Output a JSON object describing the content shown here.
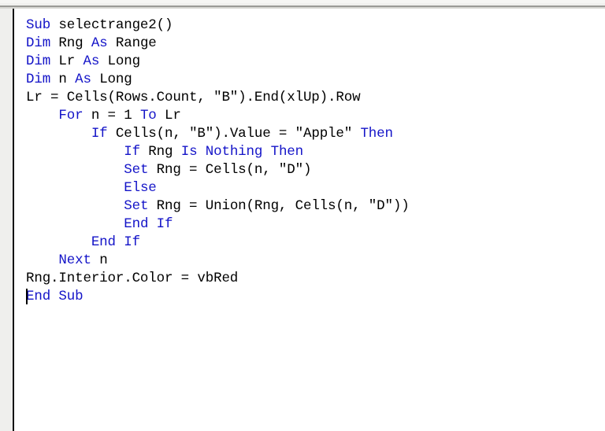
{
  "window": {
    "kind": "vba-code-editor",
    "background_color": "#ffffff",
    "chrome_color": "#f0f0ee",
    "margin_bar_color": "#efefed",
    "divider_color": "#101010",
    "keyword_color": "#1414c8",
    "text_color": "#000000"
  },
  "editor": {
    "font_size_px": 17.5,
    "line_height_px": 23,
    "caret_visible": true,
    "caret_line": 15,
    "caret_column": 1,
    "procedure_name": "selectrange2",
    "lines": [
      {
        "number": 1,
        "indent": 0,
        "text": "Sub selectrange2()",
        "tokens": [
          {
            "t": "Sub",
            "kw": true
          },
          {
            "t": " selectrange2()",
            "kw": false
          }
        ]
      },
      {
        "number": 2,
        "indent": 0,
        "text": "Dim Rng As Range",
        "tokens": [
          {
            "t": "Dim",
            "kw": true
          },
          {
            "t": " Rng ",
            "kw": false
          },
          {
            "t": "As",
            "kw": true
          },
          {
            "t": " Range",
            "kw": false
          }
        ]
      },
      {
        "number": 3,
        "indent": 0,
        "text": "Dim Lr As Long",
        "tokens": [
          {
            "t": "Dim",
            "kw": true
          },
          {
            "t": " Lr ",
            "kw": false
          },
          {
            "t": "As",
            "kw": true
          },
          {
            "t": " Long",
            "kw": false
          }
        ]
      },
      {
        "number": 4,
        "indent": 0,
        "text": "Dim n As Long",
        "tokens": [
          {
            "t": "Dim",
            "kw": true
          },
          {
            "t": " n ",
            "kw": false
          },
          {
            "t": "As",
            "kw": true
          },
          {
            "t": " Long",
            "kw": false
          }
        ]
      },
      {
        "number": 5,
        "indent": 0,
        "text": "Lr = Cells(Rows.Count, \"B\").End(xlUp).Row",
        "tokens": [
          {
            "t": "Lr = Cells(Rows.Count, \"B\").End(xlUp).Row",
            "kw": false
          }
        ]
      },
      {
        "number": 6,
        "indent": 4,
        "text": "    For n = 1 To Lr",
        "tokens": [
          {
            "t": "    ",
            "kw": false
          },
          {
            "t": "For",
            "kw": true
          },
          {
            "t": " n = 1 ",
            "kw": false
          },
          {
            "t": "To",
            "kw": true
          },
          {
            "t": " Lr",
            "kw": false
          }
        ]
      },
      {
        "number": 7,
        "indent": 8,
        "text": "        If Cells(n, \"B\").Value = \"Apple\" Then",
        "tokens": [
          {
            "t": "        ",
            "kw": false
          },
          {
            "t": "If",
            "kw": true
          },
          {
            "t": " Cells(n, \"B\").Value = \"Apple\" ",
            "kw": false
          },
          {
            "t": "Then",
            "kw": true
          }
        ]
      },
      {
        "number": 8,
        "indent": 12,
        "text": "            If Rng Is Nothing Then",
        "tokens": [
          {
            "t": "            ",
            "kw": false
          },
          {
            "t": "If",
            "kw": true
          },
          {
            "t": " Rng ",
            "kw": false
          },
          {
            "t": "Is Nothing Then",
            "kw": true
          }
        ]
      },
      {
        "number": 9,
        "indent": 12,
        "text": "            Set Rng = Cells(n, \"D\")",
        "tokens": [
          {
            "t": "            ",
            "kw": false
          },
          {
            "t": "Set",
            "kw": true
          },
          {
            "t": " Rng = Cells(n, \"D\")",
            "kw": false
          }
        ]
      },
      {
        "number": 10,
        "indent": 12,
        "text": "            Else",
        "tokens": [
          {
            "t": "            ",
            "kw": false
          },
          {
            "t": "Else",
            "kw": true
          }
        ]
      },
      {
        "number": 11,
        "indent": 12,
        "text": "            Set Rng = Union(Rng, Cells(n, \"D\"))",
        "tokens": [
          {
            "t": "            ",
            "kw": false
          },
          {
            "t": "Set",
            "kw": true
          },
          {
            "t": " Rng = Union(Rng, Cells(n, \"D\"))",
            "kw": false
          }
        ]
      },
      {
        "number": 12,
        "indent": 12,
        "text": "            End If",
        "tokens": [
          {
            "t": "            ",
            "kw": false
          },
          {
            "t": "End If",
            "kw": true
          }
        ]
      },
      {
        "number": 13,
        "indent": 8,
        "text": "        End If",
        "tokens": [
          {
            "t": "        ",
            "kw": false
          },
          {
            "t": "End If",
            "kw": true
          }
        ]
      },
      {
        "number": 14,
        "indent": 4,
        "text": "    Next n",
        "tokens": [
          {
            "t": "    ",
            "kw": false
          },
          {
            "t": "Next",
            "kw": true
          },
          {
            "t": " n",
            "kw": false
          }
        ]
      },
      {
        "number": 15,
        "indent": 0,
        "text": "Rng.Interior.Color = vbRed",
        "tokens": [
          {
            "t": "Rng.Interior.Color = vbRed",
            "kw": false
          }
        ]
      },
      {
        "number": 16,
        "indent": 0,
        "text": "End Sub",
        "tokens": [
          {
            "t": "End Sub",
            "kw": true
          }
        ]
      },
      {
        "number": 17,
        "indent": 0,
        "text": "",
        "tokens": []
      }
    ]
  }
}
